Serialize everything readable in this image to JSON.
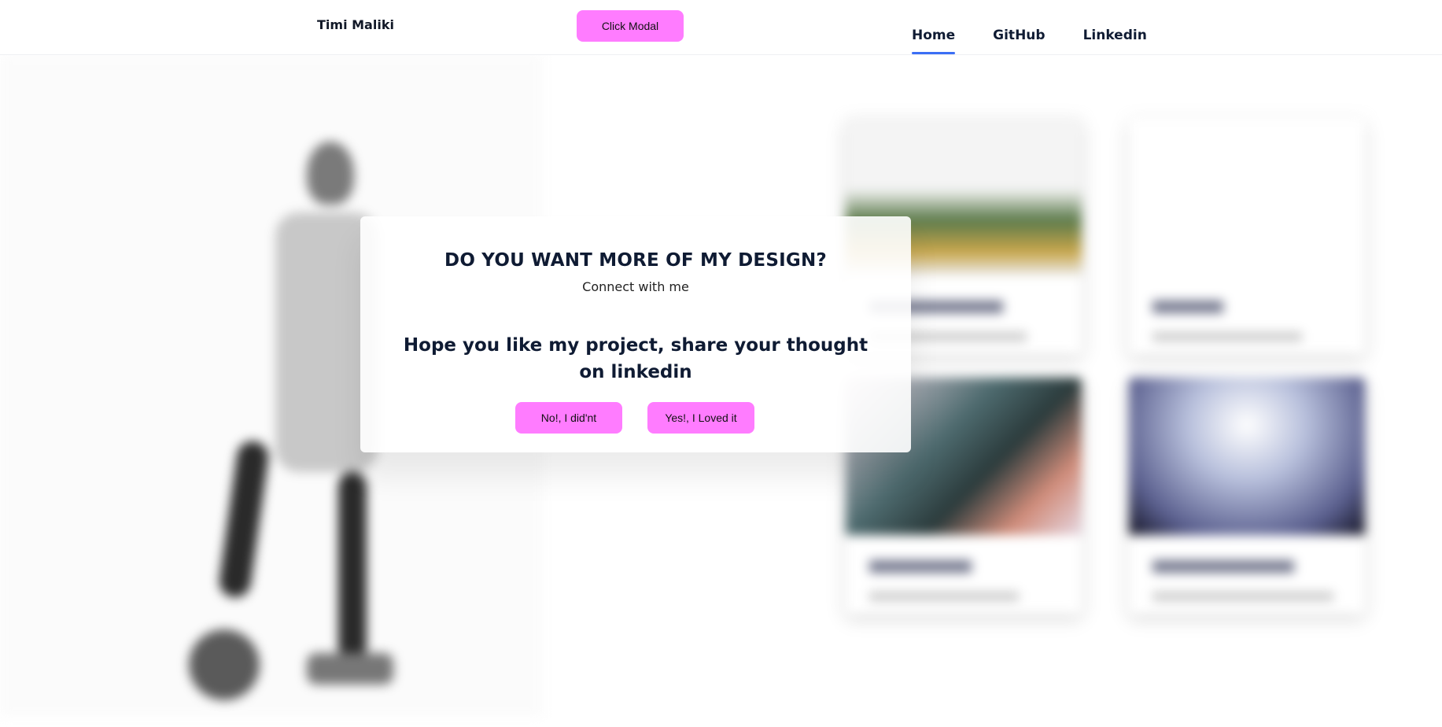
{
  "header": {
    "brand": "Timi Maliki",
    "modal_button_label": "Click Modal",
    "nav": [
      {
        "label": "Home",
        "active": true
      },
      {
        "label": "GitHub",
        "active": false
      },
      {
        "label": "Linkedin",
        "active": false
      }
    ]
  },
  "modal": {
    "title": "DO YOU WANT MORE OF MY DESIGN?",
    "subtitle": "Connect with me",
    "question": "Hope you like my project, share your thought on linkedin",
    "no_label": "No!, I did'nt",
    "yes_label": "Yes!, I Loved it"
  },
  "colors": {
    "accent_button": "#ff7cff",
    "nav_underline": "#3b6ef5",
    "text_dark": "#0f1b33"
  }
}
